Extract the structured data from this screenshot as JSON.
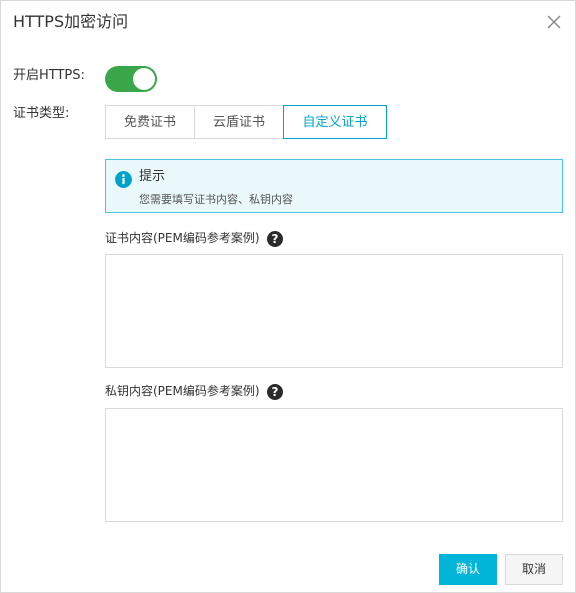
{
  "dialog": {
    "title": "HTTPS加密访问"
  },
  "https_toggle": {
    "label": "开启HTTPS:",
    "enabled": true
  },
  "cert_type": {
    "label": "证书类型:",
    "options": [
      "免费证书",
      "云盾证书",
      "自定义证书"
    ],
    "selected": "自定义证书"
  },
  "tip": {
    "title": "提示",
    "text": "您需要填写证书内容、私钥内容"
  },
  "cert_content": {
    "label": "证书内容(PEM编码参考案例)",
    "value": ""
  },
  "private_key": {
    "label": "私钥内容(PEM编码参考案例)",
    "value": ""
  },
  "buttons": {
    "confirm": "确认",
    "cancel": "取消"
  },
  "colors": {
    "accent": "#00a2ca",
    "toggle_on": "#3aa64a",
    "primary_button": "#00b5d8"
  }
}
